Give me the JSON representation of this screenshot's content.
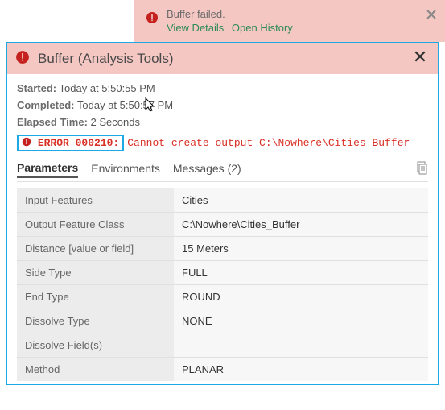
{
  "notification": {
    "title": "Buffer failed.",
    "view_details": "View Details",
    "open_history": "Open History"
  },
  "header": {
    "title": "Buffer (Analysis Tools)"
  },
  "meta": {
    "started_label": "Started:",
    "started_value": "Today at 5:50:55 PM",
    "completed_label": "Completed:",
    "completed_value": "Today at 5:50:57 PM",
    "elapsed_label": "Elapsed Time:",
    "elapsed_value": "2 Seconds"
  },
  "error": {
    "code": "ERROR 000210:",
    "message": "Cannot create output C:\\Nowhere\\Cities_Buffer"
  },
  "tabs": {
    "parameters": "Parameters",
    "environments": "Environments",
    "messages": "Messages (2)"
  },
  "parameters": [
    {
      "name": "Input Features",
      "value": "Cities"
    },
    {
      "name": "Output Feature Class",
      "value": "C:\\Nowhere\\Cities_Buffer"
    },
    {
      "name": "Distance [value or field]",
      "value": "15 Meters"
    },
    {
      "name": "Side Type",
      "value": "FULL"
    },
    {
      "name": "End Type",
      "value": "ROUND"
    },
    {
      "name": "Dissolve Type",
      "value": "NONE"
    },
    {
      "name": "Dissolve Field(s)",
      "value": ""
    },
    {
      "name": "Method",
      "value": "PLANAR"
    }
  ]
}
